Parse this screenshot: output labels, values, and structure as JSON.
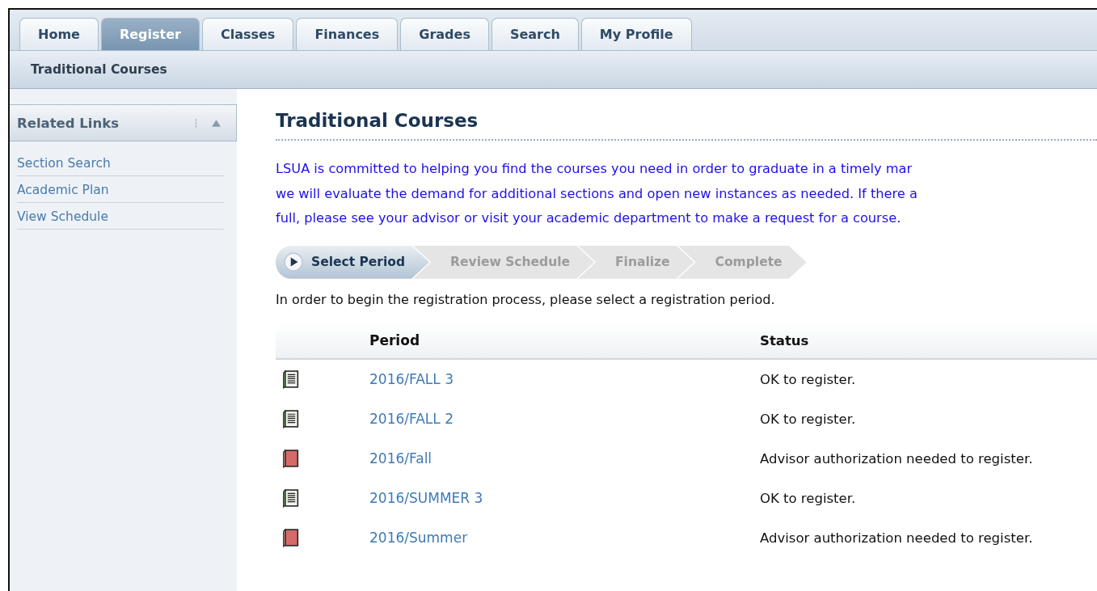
{
  "tabs": [
    {
      "label": "Home",
      "selected": false
    },
    {
      "label": "Register",
      "selected": true
    },
    {
      "label": "Classes",
      "selected": false
    },
    {
      "label": "Finances",
      "selected": false
    },
    {
      "label": "Grades",
      "selected": false
    },
    {
      "label": "Search",
      "selected": false
    },
    {
      "label": "My Profile",
      "selected": false
    }
  ],
  "subnav": {
    "label": "Traditional Courses"
  },
  "sidebar": {
    "title": "Related Links",
    "expanded": true,
    "items": [
      {
        "label": "Section Search"
      },
      {
        "label": "Academic Plan"
      },
      {
        "label": "View Schedule"
      }
    ]
  },
  "main": {
    "title": "Traditional Courses",
    "intro_lines": [
      "LSUA is committed to helping you find the courses you need in order to graduate in a timely mar",
      "we will evaluate the demand for additional sections and open new instances as needed. If there a",
      "full, please see your advisor or visit your academic department to make a request for a course."
    ],
    "steps": [
      {
        "label": "Select Period",
        "selected": true
      },
      {
        "label": "Review Schedule",
        "selected": false
      },
      {
        "label": "Finalize",
        "selected": false
      },
      {
        "label": "Complete",
        "selected": false
      }
    ],
    "instruction": "In order to begin the registration process, please select a registration period.",
    "table": {
      "columns": [
        "Period",
        "Status"
      ],
      "rows": [
        {
          "kind": "ok",
          "period": "2016/FALL 3",
          "status": "OK to register."
        },
        {
          "kind": "ok",
          "period": "2016/FALL 2",
          "status": "OK to register."
        },
        {
          "kind": "blocked",
          "period": "2016/Fall",
          "status": "Advisor authorization needed to register."
        },
        {
          "kind": "ok",
          "period": "2016/SUMMER 3",
          "status": "OK to register."
        },
        {
          "kind": "blocked",
          "period": "2016/Summer",
          "status": "Advisor authorization needed to register."
        }
      ]
    }
  }
}
